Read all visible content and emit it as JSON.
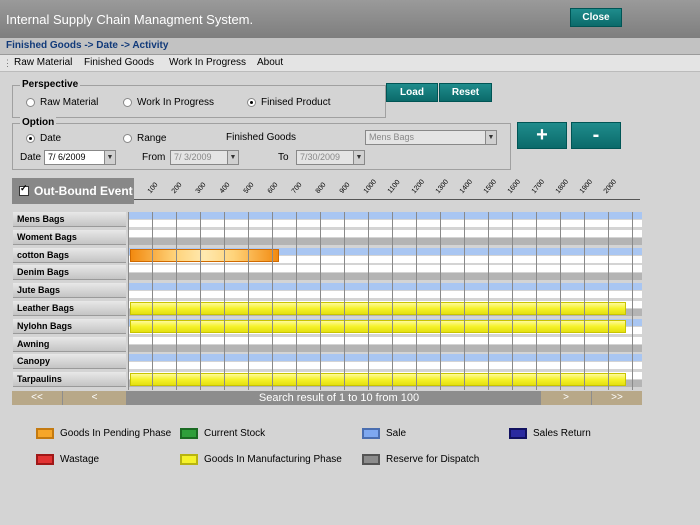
{
  "app": {
    "title": "Internal Supply Chain Managment System.",
    "close_label": "Close"
  },
  "breadcrumb": "Finished Goods -> Date -> Activity",
  "menu": [
    "Raw Material",
    "Finished Goods",
    "Work In Progress",
    "About"
  ],
  "perspective": {
    "legend": "Perspective",
    "options": [
      {
        "label": "Raw Material",
        "selected": false
      },
      {
        "label": "Work In Progress",
        "selected": false
      },
      {
        "label": "Finised Product",
        "selected": true
      }
    ]
  },
  "buttons": {
    "load": "Load",
    "reset": "Reset",
    "zoom_in": "+",
    "zoom_out": "-"
  },
  "option": {
    "legend": "Option",
    "date_radio": "Date",
    "range_radio": "Range",
    "date_selected": true,
    "finished_goods_label": "Finished Goods",
    "finished_goods_value": "Mens Bags",
    "date_label": "Date",
    "date_value": "7/ 6/2009",
    "from_label": "From",
    "from_value": "7/ 3/2009",
    "to_label": "To",
    "to_value": "7/30/2009"
  },
  "event": {
    "label": "Out-Bound Event",
    "checked": true
  },
  "scale_ticks": [
    "100",
    "200",
    "300",
    "400",
    "500",
    "600",
    "700",
    "800",
    "900",
    "1000",
    "1100",
    "1200",
    "1300",
    "1400",
    "1500",
    "1600",
    "1700",
    "1800",
    "1900",
    "2000"
  ],
  "rows": [
    {
      "label": "Mens Bags",
      "bar": null
    },
    {
      "label": "Woment Bags",
      "bar": null
    },
    {
      "label": "cotton Bags",
      "bar": {
        "type": "pending",
        "start": 0,
        "end": 600
      }
    },
    {
      "label": "Denim Bags",
      "bar": null
    },
    {
      "label": "Jute Bags",
      "bar": null
    },
    {
      "label": "Leather Bags",
      "bar": {
        "type": "manufacturing",
        "start": 0,
        "end": 2000
      }
    },
    {
      "label": "Nylohn Bags",
      "bar": {
        "type": "manufacturing",
        "start": 0,
        "end": 2000
      }
    },
    {
      "label": "Awning",
      "bar": null
    },
    {
      "label": "Canopy",
      "bar": null
    },
    {
      "label": "Tarpaulins",
      "bar": {
        "type": "manufacturing",
        "start": 0,
        "end": 2000
      }
    }
  ],
  "pager": {
    "first": "<<",
    "prev": "<",
    "next": ">",
    "last": ">>",
    "text": "Search result of 1 to 10 from 100"
  },
  "legend": [
    {
      "label": "Goods In Pending Phase",
      "color": "#f6a629"
    },
    {
      "label": "Current Stock",
      "color": "#2e9e3a"
    },
    {
      "label": "Sale",
      "color": "#7ea8f0"
    },
    {
      "label": "Sales Return",
      "color": "#2a2aa0"
    },
    {
      "label": "Wastage",
      "color": "#e23333"
    },
    {
      "label": "Goods In Manufacturing Phase",
      "color": "#f5f22a"
    },
    {
      "label": "Reserve for Dispatch",
      "color": "#8c8c8c"
    }
  ],
  "colors": {
    "accent": "#0e7474",
    "stripe_blue": "#a9c6f2",
    "stripe_gray": "#b4b4b4"
  }
}
